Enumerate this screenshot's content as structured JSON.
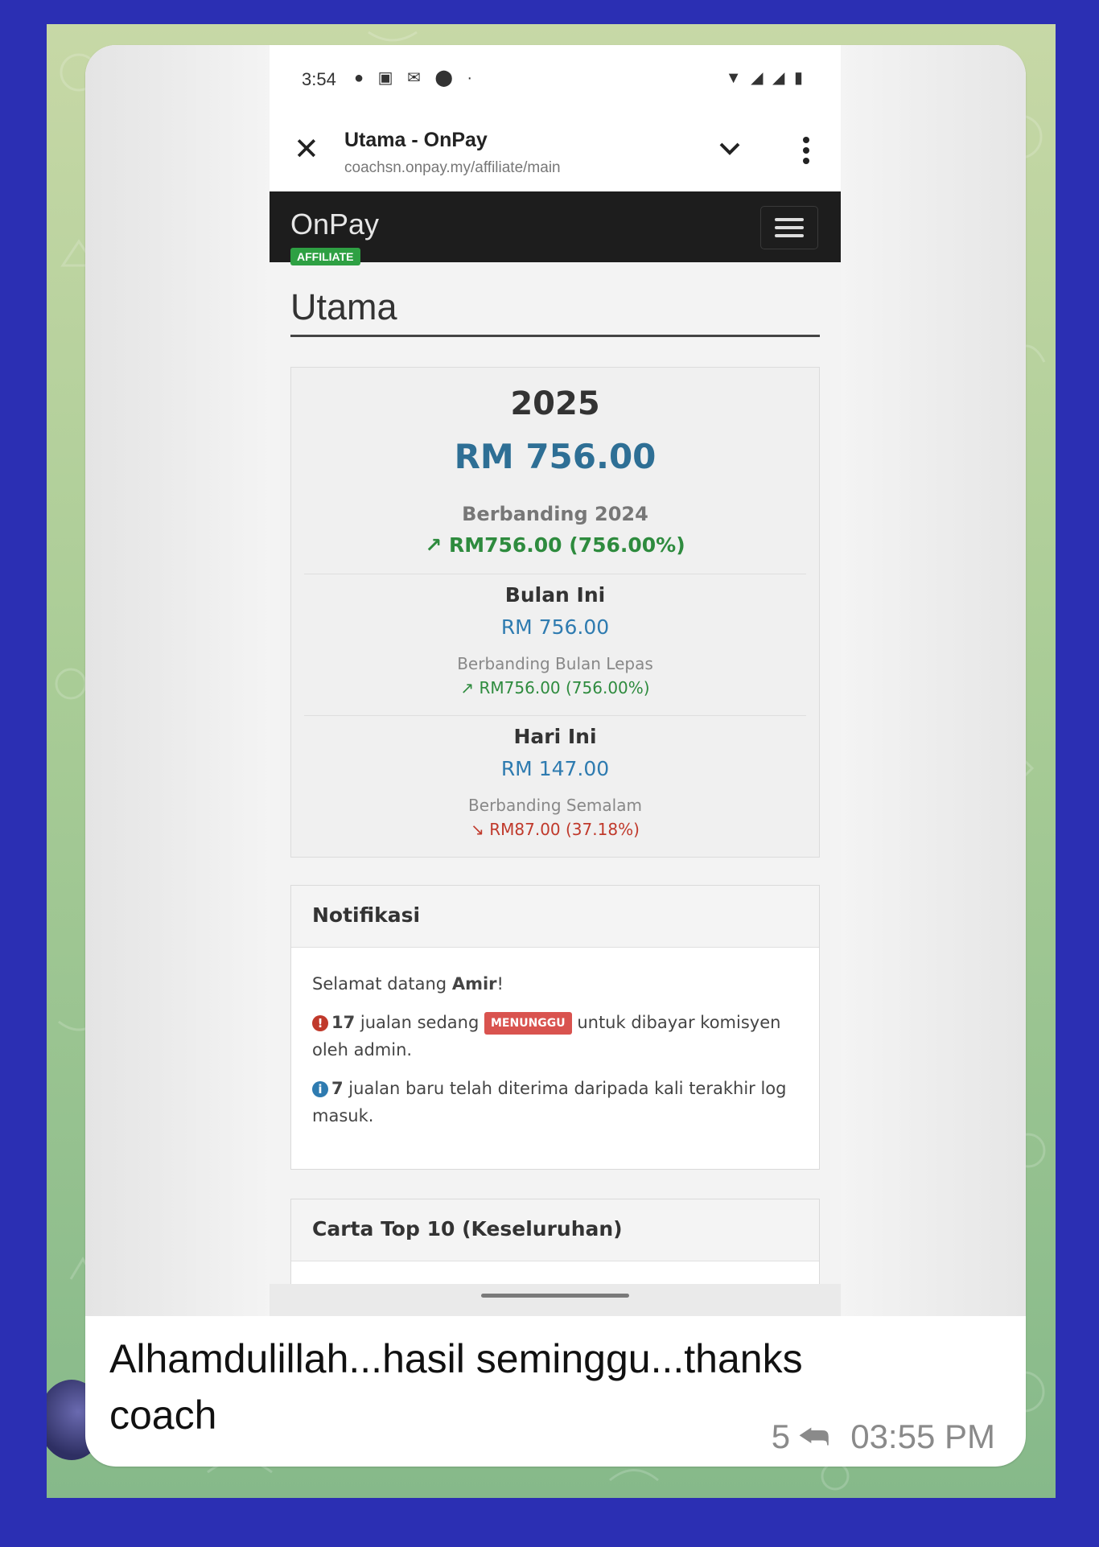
{
  "phone": {
    "status_time": "3:54",
    "status_icons": [
      "chat-icon",
      "youtube-icon",
      "gmail-icon",
      "circle-icon",
      "dot-icon"
    ],
    "system_icons": [
      "wifi-icon",
      "signal-icon",
      "signal-icon",
      "battery-icon"
    ],
    "browser": {
      "title": "Utama - OnPay",
      "url": "coachsn.onpay.my/affiliate/main"
    },
    "nav": {
      "logo": "OnPay",
      "badge": "AFFILIATE"
    },
    "page_title": "Utama",
    "stats": {
      "year": "2025",
      "year_amount": "RM 756.00",
      "compare_year_label": "Berbanding 2024",
      "compare_year_value": "↗ RM756.00  (756.00%)",
      "month_label": "Bulan Ini",
      "month_amount": "RM 756.00",
      "compare_month_label": "Berbanding Bulan Lepas",
      "compare_month_value": "↗ RM756.00  (756.00%)",
      "today_label": "Hari Ini",
      "today_amount": "RM 147.00",
      "compare_today_label": "Berbanding Semalam",
      "compare_today_value": "↘ RM87.00  (37.18%)"
    },
    "notifications": {
      "title": "Notifikasi",
      "welcome_prefix": "Selamat datang ",
      "user": "Amir",
      "welcome_suffix": "!",
      "pending_count": "17",
      "pending_text_a": " jualan sedang ",
      "pending_badge": "MENUNGGU",
      "pending_text_b": " untuk dibayar komisyen oleh admin.",
      "new_count": "7",
      "new_text": " jualan baru telah diterima daripada kali terakhir log masuk."
    },
    "top10": {
      "title": "Carta Top 10 (Keseluruhan)"
    }
  },
  "message": {
    "text": "Alhamdulillah...hasil seminggu...thanks coach",
    "reply_count": "5",
    "time": "03:55 PM"
  },
  "colors": {
    "outer_bg": "#2b2fb3",
    "amount_blue": "#2e6f95",
    "up_green": "#2e8b3e",
    "down_red": "#c0392b",
    "badge_green": "#2ea043"
  }
}
